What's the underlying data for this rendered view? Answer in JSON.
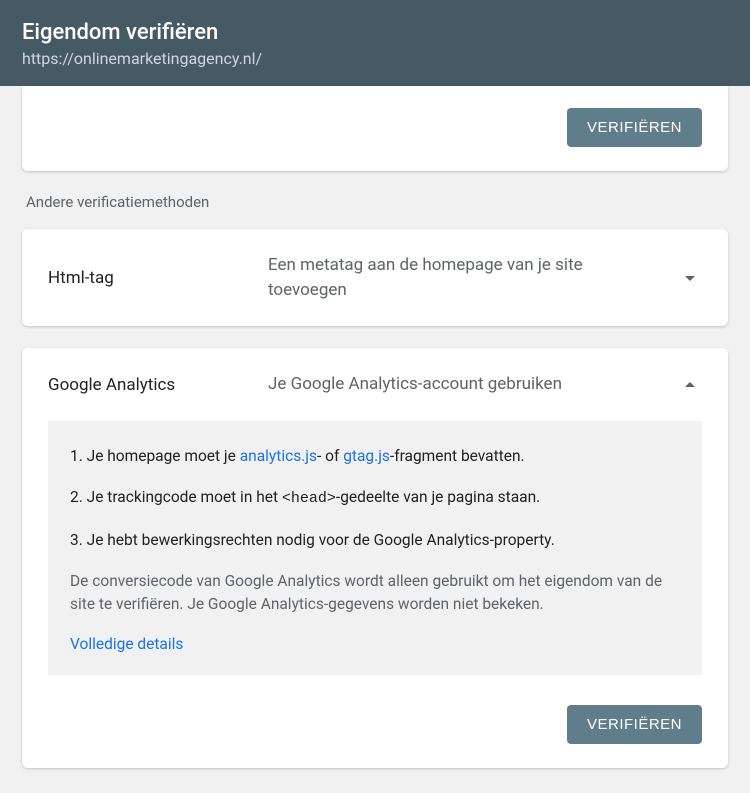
{
  "header": {
    "title": "Eigendom verifiëren",
    "subtitle": "https://onlinemarketingagency.nl/"
  },
  "top_card": {
    "verify_label": "VERIFIËREN"
  },
  "section_label": "Andere verificatiemethoden",
  "methods": {
    "html_tag": {
      "name": "Html-tag",
      "description": "Een metatag aan de homepage van je site toevoegen"
    },
    "google_analytics": {
      "name": "Google Analytics",
      "description": "Je Google Analytics-account gebruiken",
      "step1_pre": "Je homepage moet je ",
      "step1_link1": "analytics.js",
      "step1_mid": "- of ",
      "step1_link2": "gtag.js",
      "step1_post": "-fragment bevatten.",
      "step2_pre": "Je trackingcode moet in het ",
      "step2_code": "<head>",
      "step2_post": "-gedeelte van je pagina staan.",
      "step3": "Je hebt bewerkingsrechten nodig voor de Google Analytics-property.",
      "note": "De conversiecode van Google Analytics wordt alleen gebruikt om het eigendom van de site te verifiëren. Je Google Analytics-gegevens worden niet bekeken.",
      "details_link": "Volledige details",
      "verify_label": "VERIFIËREN"
    }
  }
}
